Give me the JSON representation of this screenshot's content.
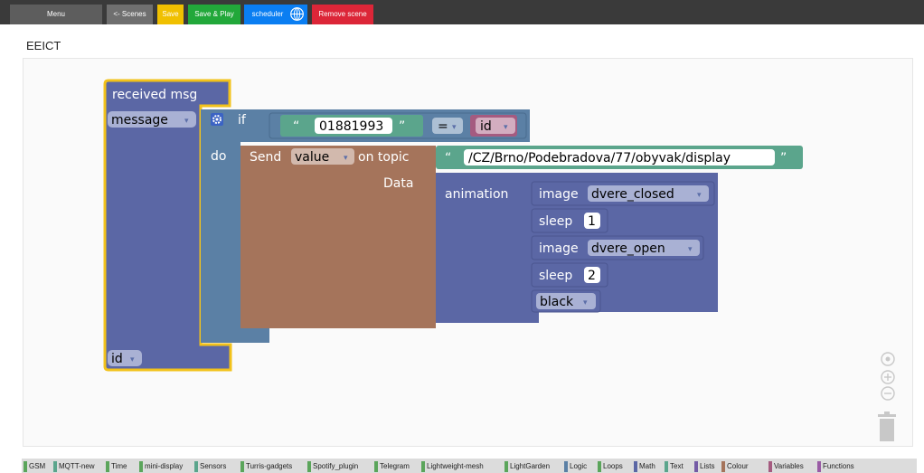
{
  "toolbar": {
    "menu_label": "Menu",
    "scenes_label": "<- Scenes",
    "save_label": "Save",
    "save_play_label": "Save & Play",
    "scheduler_label": "scheduler",
    "remove_label": "Remove scene"
  },
  "page": {
    "title": "EEICT"
  },
  "blocks": {
    "event_label": "received msg",
    "event_var": "message",
    "event_bottom_var": "id",
    "if_label": "if",
    "do_label": "do",
    "compare_text": "01881993",
    "compare_op": "=",
    "compare_var": "id",
    "send_label": "Send",
    "send_field": "value",
    "on_topic_label": "on topic",
    "topic_text": "/CZ/Brno/Podebradova/77/obyvak/display",
    "data_label": "Data",
    "animation_label": "animation",
    "image_label": "image",
    "image1_value": "dvere_closed",
    "sleep_label": "sleep",
    "sleep1_value": "1",
    "image2_value": "dvere_open",
    "sleep2_value": "2",
    "color_value": "black",
    "open_quote": "“",
    "close_quote": "”",
    "dropdown_arrow": "▾"
  },
  "toolbox": {
    "categories": [
      {
        "label": "GSM",
        "color": "#5ba55b"
      },
      {
        "label": "MQTT-new",
        "color": "#5ba58c"
      },
      {
        "label": "Time",
        "color": "#5ba55b"
      },
      {
        "label": "mini-display",
        "color": "#5ba55b"
      },
      {
        "label": "Sensors",
        "color": "#5ba58c"
      },
      {
        "label": "Turris-gadgets",
        "color": "#5ba55b"
      },
      {
        "label": "Spotify_plugin",
        "color": "#5ba55b"
      },
      {
        "label": "Telegram",
        "color": "#5ba55b"
      },
      {
        "label": "Lightweight-mesh",
        "color": "#5ba55b"
      },
      {
        "label": "LightGarden",
        "color": "#5ba55b"
      },
      {
        "label": "Logic",
        "color": "#5b80a5"
      },
      {
        "label": "Loops",
        "color": "#5ba55b"
      },
      {
        "label": "Math",
        "color": "#5b67a5"
      },
      {
        "label": "Text",
        "color": "#5ba58c"
      },
      {
        "label": "Lists",
        "color": "#745ba5"
      },
      {
        "label": "Colour",
        "color": "#a5745b"
      },
      {
        "label": "Variables",
        "color": "#a55b80"
      },
      {
        "label": "Functions",
        "color": "#995ba5"
      }
    ]
  },
  "colors": {
    "event_block": "#5b67a5",
    "event_outline": "#f2c21b",
    "logic_block": "#5b80a5",
    "text_block": "#5ba58c",
    "send_block": "#a5745b",
    "animation_block": "#5b67a5"
  },
  "icons": {
    "gear": "gear-icon",
    "scheduler": "globe-icon",
    "recenter": "target-icon",
    "zoom_in": "zoom-in-icon",
    "zoom_out": "zoom-out-icon",
    "trash": "trash-icon"
  }
}
